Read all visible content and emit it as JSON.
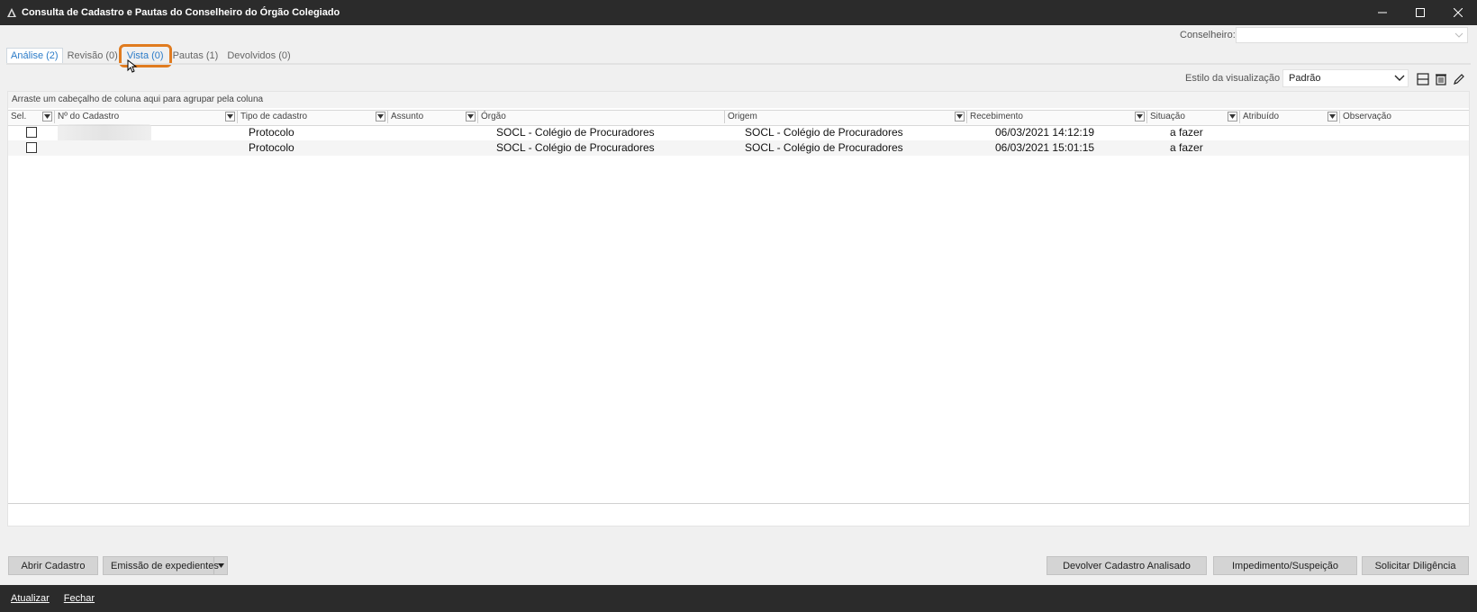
{
  "window": {
    "title": "Consulta de Cadastro e Pautas do Conselheiro do Órgão Colegiado"
  },
  "conselheiro": {
    "label": "Conselheiro:",
    "value": ""
  },
  "tabs": [
    {
      "label": "Análise (2)"
    },
    {
      "label": "Revisão (0)"
    },
    {
      "label": "Vista (0)"
    },
    {
      "label": "Pautas (1)"
    },
    {
      "label": "Devolvidos (0)"
    }
  ],
  "toolbar": {
    "viz_label": "Estilo da visualização",
    "viz_value": "Padrão",
    "icons": [
      "save-layout-icon",
      "delete-layout-icon",
      "edit-layout-icon"
    ]
  },
  "grid": {
    "group_hint": "Arraste um cabeçalho de coluna aqui para agrupar pela coluna",
    "columns": [
      "Sel.",
      "Nº do Cadastro",
      "Tipo de cadastro",
      "Assunto",
      "Órgão",
      "Origem",
      "Recebimento",
      "Situação",
      "Atribuído",
      "Observação"
    ],
    "rows": [
      {
        "tipo": "Protocolo",
        "orgao": "SOCL - Colégio de Procuradores",
        "origem": "SOCL - Colégio de Procuradores",
        "recebimento": "06/03/2021 14:12:19",
        "situacao": "a fazer"
      },
      {
        "tipo": "Protocolo",
        "orgao": "SOCL - Colégio de Procuradores",
        "origem": "SOCL - Colégio de Procuradores",
        "recebimento": "06/03/2021 15:01:15",
        "situacao": "a fazer"
      }
    ]
  },
  "buttons": {
    "abrir": "Abrir Cadastro",
    "emissao": "Emissão de expedientes",
    "devolver": "Devolver Cadastro Analisado",
    "impedimento": "Impedimento/Suspeição",
    "diligencia": "Solicitar Diligência"
  },
  "statusbar": {
    "atualizar": "Atualizar",
    "fechar": "Fechar"
  },
  "colors": {
    "highlight": "#e07b1f",
    "active_tab": "#2b7bc8",
    "titlebar": "#2b2b2b"
  }
}
